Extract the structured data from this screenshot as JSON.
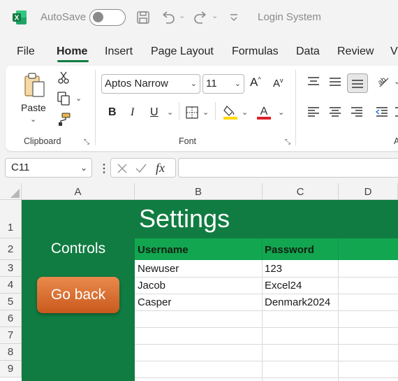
{
  "titlebar": {
    "autosave_label": "AutoSave",
    "title": "Login System",
    "colors": {
      "excel_green": "#107c41"
    }
  },
  "menu": {
    "tabs": [
      "File",
      "Home",
      "Insert",
      "Page Layout",
      "Formulas",
      "Data",
      "Review",
      "V"
    ],
    "active": "Home"
  },
  "ribbon": {
    "paste_label": "Paste",
    "font_name": "Aptos Narrow",
    "font_size": "11",
    "groups": {
      "clipboard": "Clipboard",
      "font": "Font",
      "alignment": "A"
    }
  },
  "formula_bar": {
    "name_box": "C11",
    "fx": "fx",
    "formula": ""
  },
  "grid": {
    "columns": [
      "A",
      "B",
      "C",
      "D"
    ],
    "rows": [
      "1",
      "2",
      "3",
      "4",
      "5",
      "6",
      "7",
      "8",
      "9"
    ],
    "title": "Settings",
    "controls_label": "Controls",
    "go_back_label": "Go back",
    "table_headers": [
      "Username",
      "Password"
    ],
    "table_rows": [
      [
        "Newuser",
        "123"
      ],
      [
        "Jacob",
        "Excel24"
      ],
      [
        "Casper",
        "Denmark2024"
      ]
    ]
  }
}
